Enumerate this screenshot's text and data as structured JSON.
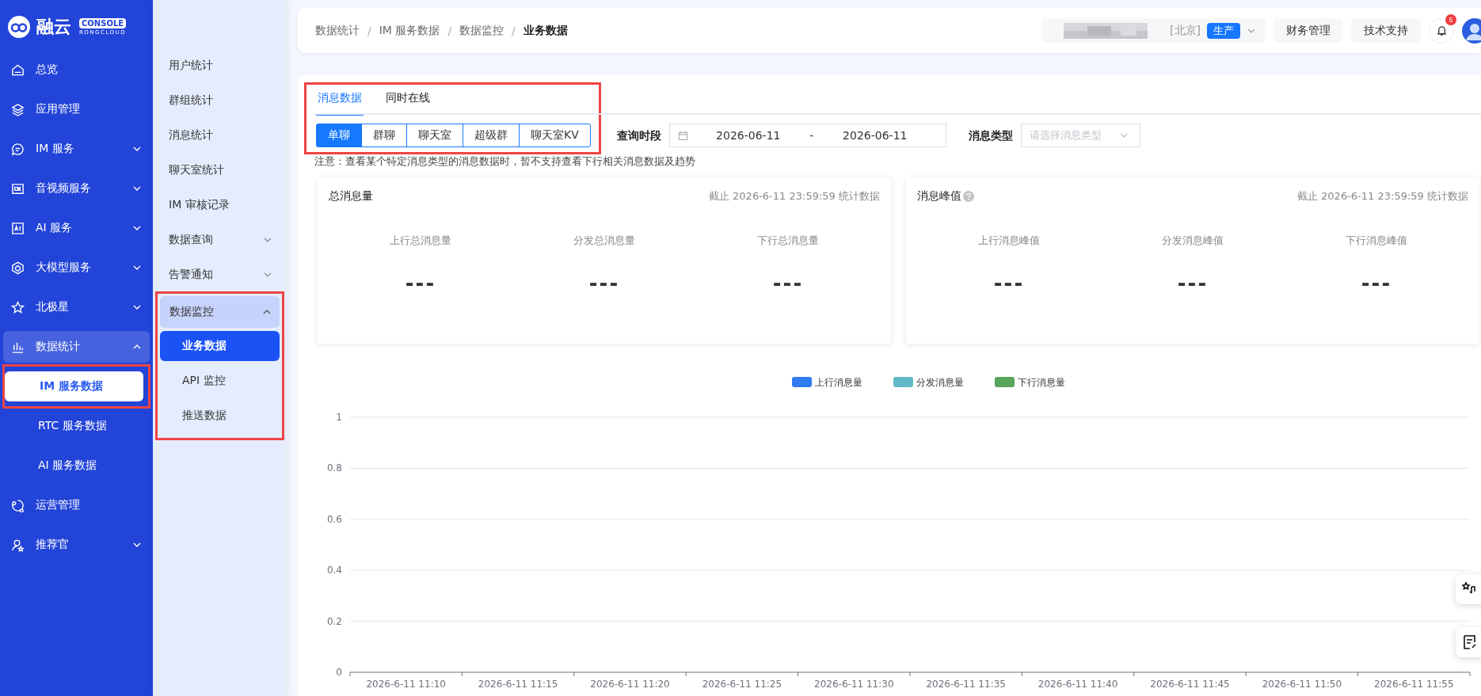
{
  "logo": {
    "name": "融云",
    "badge": "CONSOLE",
    "sub": "RONGCLOUD"
  },
  "sidebar": {
    "items": [
      {
        "label": "总览"
      },
      {
        "label": "应用管理"
      },
      {
        "label": "IM 服务",
        "expanded": false
      },
      {
        "label": "音视频服务",
        "expanded": false
      },
      {
        "label": "AI 服务",
        "expanded": false
      },
      {
        "label": "大模型服务",
        "expanded": false
      },
      {
        "label": "北极星",
        "expanded": false
      },
      {
        "label": "数据统计",
        "expanded": true,
        "children": [
          {
            "label": "IM 服务数据",
            "selected": true,
            "highlighted": true
          },
          {
            "label": "RTC 服务数据",
            "selected": false,
            "highlighted": false
          },
          {
            "label": "AI 服务数据",
            "selected": false,
            "highlighted": false
          }
        ]
      },
      {
        "label": "运营管理"
      },
      {
        "label": "推荐官",
        "expanded": false
      }
    ]
  },
  "subnav": {
    "items": [
      {
        "label": "用户统计"
      },
      {
        "label": "群组统计"
      },
      {
        "label": "消息统计"
      },
      {
        "label": "聊天室统计"
      },
      {
        "label": "IM 审核记录"
      },
      {
        "label": "数据查询",
        "expanded": false
      },
      {
        "label": "告警通知",
        "expanded": false
      },
      {
        "label": "数据监控",
        "expanded": true,
        "highlighted": true,
        "children": [
          {
            "label": "业务数据",
            "selected": true
          },
          {
            "label": "API 监控",
            "selected": false
          },
          {
            "label": "推送数据",
            "selected": false
          }
        ]
      }
    ]
  },
  "breadcrumb": [
    "数据统计",
    "IM 服务数据",
    "数据监控",
    "业务数据"
  ],
  "breadcrumb_separator": "/",
  "app_selector": {
    "region": "[北京]",
    "env": "生产"
  },
  "header_buttons": [
    "财务管理",
    "技术支持"
  ],
  "notifications": {
    "count": "5"
  },
  "tabs_highlighted": true,
  "tabs": [
    {
      "label": "消息数据",
      "selected": true
    },
    {
      "label": "同时在线",
      "selected": false
    }
  ],
  "segments": [
    {
      "label": "单聊",
      "selected": true
    },
    {
      "label": "群聊",
      "selected": false
    },
    {
      "label": "聊天室",
      "selected": false
    },
    {
      "label": "超级群",
      "selected": false
    },
    {
      "label": "聊天室KV",
      "selected": false
    }
  ],
  "filters": {
    "period_label": "查询时段",
    "start": "2026-06-11",
    "separator": "-",
    "end": "2026-06-11",
    "type_label": "消息类型",
    "type_placeholder": "请选择消息类型"
  },
  "note": "注意：查看某个特定消息类型的消息数据时，暂不支持查看下行相关消息数据及趋势",
  "cards": [
    {
      "title": "总消息量",
      "help": false,
      "meta": "截止 2026-6-11 23:59:59 统计数据",
      "metrics": [
        {
          "label": "上行总消息量",
          "value": "---"
        },
        {
          "label": "分发总消息量",
          "value": "---"
        },
        {
          "label": "下行总消息量",
          "value": "---"
        }
      ]
    },
    {
      "title": "消息峰值",
      "help": true,
      "meta": "截止 2026-6-11 23:59:59 统计数据",
      "metrics": [
        {
          "label": "上行消息峰值",
          "value": "---"
        },
        {
          "label": "分发消息峰值",
          "value": "---"
        },
        {
          "label": "下行消息峰值",
          "value": "---"
        }
      ]
    }
  ],
  "chart_data": {
    "type": "line",
    "categories": [
      "2026-6-11 11:10",
      "2026-6-11 11:15",
      "2026-6-11 11:20",
      "2026-6-11 11:25",
      "2026-6-11 11:30",
      "2026-6-11 11:35",
      "2026-6-11 11:40",
      "2026-6-11 11:45",
      "2026-6-11 11:50",
      "2026-6-11 11:55"
    ],
    "ylim": [
      0,
      1
    ],
    "grid": true,
    "yticks": [
      {
        "value": 0,
        "label": "0"
      },
      {
        "value": 0.2,
        "label": "0.2"
      },
      {
        "value": 0.4,
        "label": "0.4"
      },
      {
        "value": 0.6,
        "label": "0.6"
      },
      {
        "value": 0.8,
        "label": "0.8"
      },
      {
        "value": 1,
        "label": "1"
      }
    ],
    "series": [
      {
        "name": "上行消息量",
        "color": "#2f7bef",
        "values": [
          null,
          null,
          null,
          null,
          null,
          null,
          null,
          null,
          null,
          null
        ]
      },
      {
        "name": "分发消息量",
        "color": "#62b8c6",
        "values": [
          null,
          null,
          null,
          null,
          null,
          null,
          null,
          null,
          null,
          null
        ]
      },
      {
        "name": "下行消息量",
        "color": "#58a55c",
        "values": [
          null,
          null,
          null,
          null,
          null,
          null,
          null,
          null,
          null,
          null
        ]
      }
    ]
  }
}
